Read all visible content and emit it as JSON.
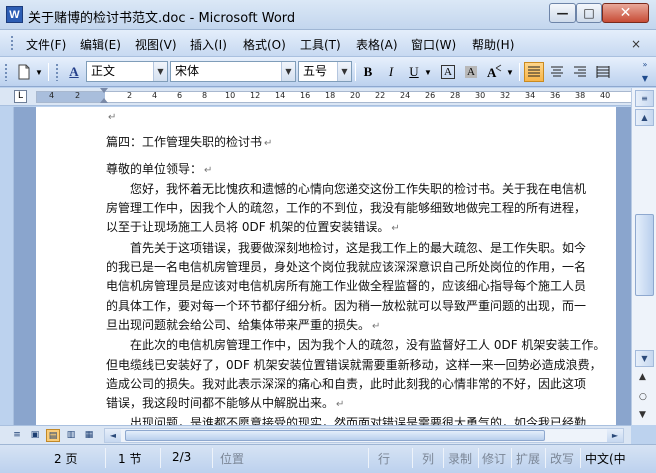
{
  "window": {
    "title": "关于赌博的检讨书范文.doc - Microsoft Word",
    "app_icon_letter": "W"
  },
  "menu": {
    "items": [
      "文件(F)",
      "编辑(E)",
      "视图(V)",
      "插入(I)",
      "格式(O)",
      "工具(T)",
      "表格(A)",
      "窗口(W)",
      "帮助(H)"
    ],
    "close_glyph": "×"
  },
  "toolbar": {
    "style_value": "正文",
    "font_value": "宋体",
    "size_value": "五号",
    "bold_label": "B",
    "italic_label": "I",
    "underline_label": "U",
    "style_icon_label": "A",
    "dropdown_glyph": "▼"
  },
  "ruler": {
    "corner_glyph": "L",
    "numbers": [
      "4",
      "2",
      "2",
      "4",
      "6",
      "8",
      "10",
      "12",
      "14",
      "16",
      "18",
      "20",
      "22",
      "24",
      "26",
      "28",
      "30",
      "32",
      "34",
      "36",
      "38",
      "40"
    ]
  },
  "document": {
    "paragraph_mark": "↵",
    "lines": [
      "",
      "篇四：工作管理失职的检讨书",
      "",
      "尊敬的单位领导：",
      "　　您好，我怀着无比愧疚和遗憾的心情向您递交这份工作失职的检讨书。关于我在电信机",
      "房管理工作中，因我个人的疏忽，工作的不到位，我没有能够细致地做完工程的所有进程，",
      "以至于让现场施工人员将 0DF 机架的位置安装错误。",
      "　　首先关于这项错误，我要做深刻地检讨，这是我工作上的最大疏忽、是工作失职。如今",
      "的我已是一名电信机房管理员，身处这个岗位我就应该深深意识自己所处岗位的作用，一名",
      "电信机房管理员是应该对电信机房所有施工作业做全程监督的，应该细心指导每个施工人员",
      "的具体工作，要对每一个环节都仔细分析。因为稍一放松就可以导致严重问题的出现，而一",
      "旦出现问题就会给公司、给集体带来严重的损失。",
      "　　在此次的电信机房管理工作中，因为我个人的疏忽，没有监督好工人 0DF 机架安装工作。",
      "但电缆线已安装好了，0DF 机架安装位置错误就需要重新移动，这样一来一回势必造成浪费，",
      "造成公司的损失。我对此表示深深的痛心和自责，此时此刻我的心情非常的不好，因此这项",
      "错误，我这段时间都不能够从中解脱出来。",
      "　　出现问题，是谁都不愿意接受的现实，然而面对错误是需要很大勇气的，如今我已经勤"
    ],
    "line_marks": [
      true,
      true,
      false,
      true,
      false,
      false,
      true,
      false,
      false,
      false,
      false,
      true,
      false,
      false,
      false,
      true,
      false
    ]
  },
  "scroll": {
    "up_glyph": "▲",
    "down_glyph": "▼",
    "left_glyph": "◄",
    "right_glyph": "►",
    "prev_page_glyph": "▲",
    "browse_glyph": "○",
    "next_page_glyph": "▼"
  },
  "view_buttons": [
    "≡",
    "▣",
    "▤",
    "▥",
    "▦"
  ],
  "status": {
    "page": "2 页",
    "section": "1 节",
    "page_of": "2/3",
    "position": "位置",
    "line": "行",
    "column": "列",
    "record": "录制",
    "revise": "修订",
    "extend": "扩展",
    "overwrite": "改写",
    "language": "中文(中"
  }
}
